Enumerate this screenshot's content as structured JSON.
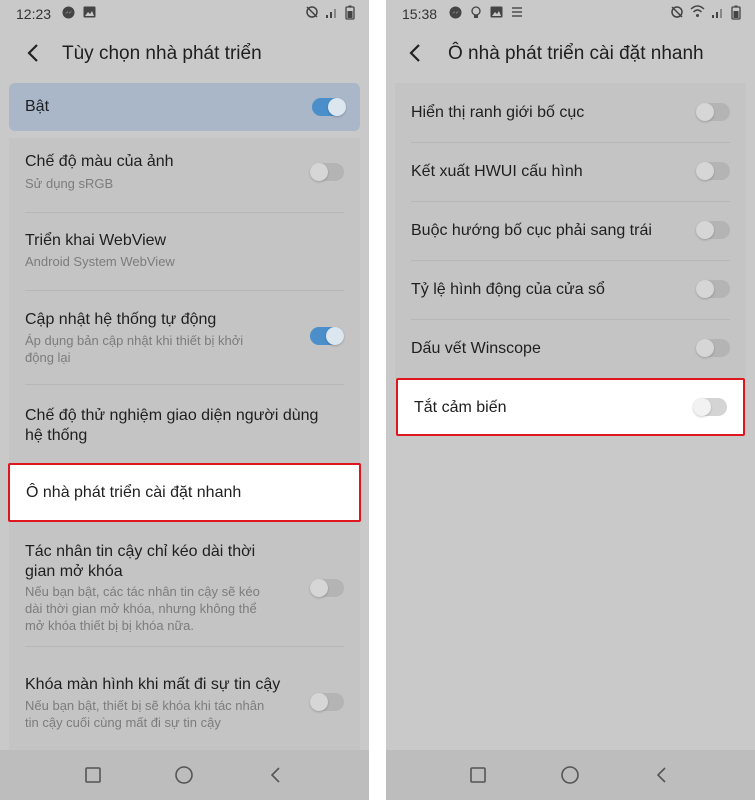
{
  "left": {
    "status_time": "12:23",
    "title": "Tùy chọn nhà phát triển",
    "master": {
      "label": "Bật",
      "on": true
    },
    "items": [
      {
        "title": "Chế độ màu của ảnh",
        "subtitle": "Sử dụng sRGB",
        "toggle": false
      },
      {
        "title": "Triển khai WebView",
        "subtitle": "Android System WebView"
      },
      {
        "title": "Cập nhật hệ thống tự động",
        "subtitle_line1": "Áp dụng bản cập nhật khi thiết bị khởi",
        "subtitle_line2": "động lại",
        "toggle": true
      },
      {
        "title_line1": "Chế độ thử nghiệm giao diện người dùng",
        "title_line2": "hệ thống"
      },
      {
        "title": "Ô nhà phát triển cài đặt nhanh",
        "highlighted": true
      },
      {
        "title_line1": "Tác nhân tin cậy chỉ kéo dài thời",
        "title_line2": "gian mở khóa",
        "subtitle_line1": "Nếu bạn bật, các tác nhân tin cậy sẽ kéo",
        "subtitle_line2": "dài thời gian mở khóa, nhưng không thể",
        "subtitle_line3": "mở khóa thiết bị bị khóa nữa.",
        "toggle": false
      },
      {
        "title": "Khóa màn hình khi mất đi sự tin cậy",
        "subtitle_line1": "Nếu bạn bật, thiết bị sẽ khóa khi tác nhân",
        "subtitle_line2": "tin cậy cuối cùng mất đi sự tin cậy",
        "toggle": false
      }
    ]
  },
  "right": {
    "status_time": "15:38",
    "title": "Ô nhà phát triển cài đặt nhanh",
    "items": [
      {
        "title": "Hiển thị ranh giới bố cục",
        "toggle": false
      },
      {
        "title": "Kết xuất HWUI cấu hình",
        "toggle": false
      },
      {
        "title": "Buộc hướng bố cục phải sang trái",
        "toggle": false
      },
      {
        "title": "Tỷ lệ hình động của cửa sổ",
        "toggle": false
      },
      {
        "title": "Dấu vết Winscope",
        "toggle": false
      },
      {
        "title": "Tắt cảm biến",
        "toggle": false,
        "highlighted": true
      }
    ]
  },
  "colors": {
    "accent": "#4a8fc9",
    "highlight_border": "#e0161f"
  }
}
